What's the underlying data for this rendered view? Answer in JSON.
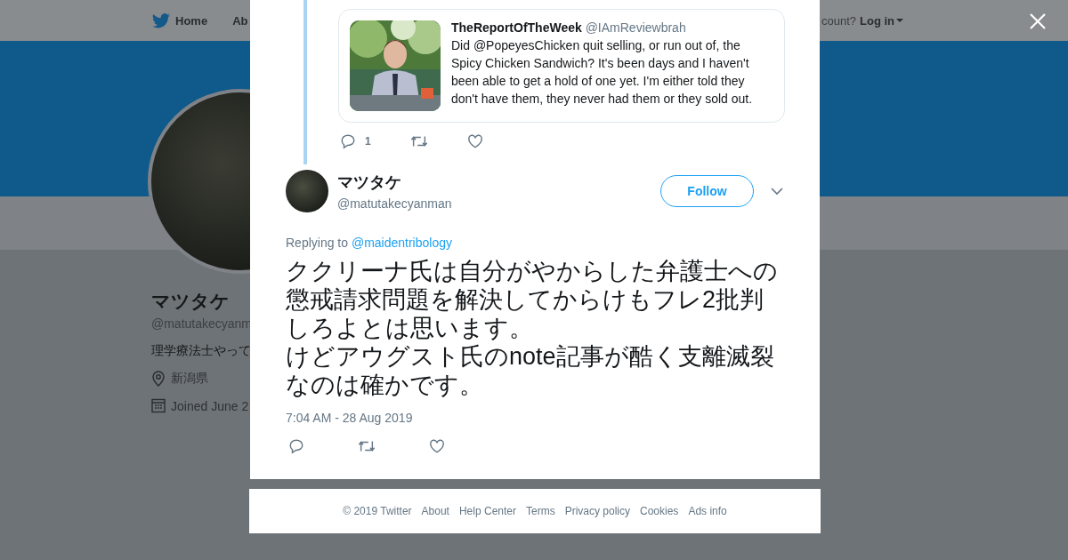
{
  "nav": {
    "items": [
      "Home",
      "Ab"
    ],
    "account_prompt": "count?",
    "login": "Log in"
  },
  "profile": {
    "name": "マツタケ",
    "handle": "@matutakecyanm",
    "bio": "理学療法士やって",
    "location": "新潟県",
    "joined": "Joined June 2"
  },
  "quoted_tweet": {
    "name": "TheReportOfTheWeek",
    "handle": "@IAmReviewbrah",
    "text": "Did @PopeyesChicken quit selling, or run out of, the Spicy Chicken Sandwich?  It's been days and I haven't been able to get a hold of one yet. I'm either told they don't have them, they never had them or they sold out.",
    "reply_count": "1"
  },
  "tweet": {
    "name": "マツタケ",
    "handle": "@matutakecyanman",
    "follow": "Follow",
    "replying_label": "Replying to",
    "replying_to": "@maidentribology",
    "text": [
      "ククリーナ氏は自分がやからした弁護士への懲戒請求問題を解決してからけもフレ2批判しろよとは思います。",
      "けどアウグスト氏のnote記事が酷く支離滅裂なのは確かです。"
    ],
    "timestamp": "7:04 AM - 28 Aug 2019"
  },
  "footer": [
    "© 2019 Twitter",
    "About",
    "Help Center",
    "Terms",
    "Privacy policy",
    "Cookies",
    "Ads info"
  ]
}
